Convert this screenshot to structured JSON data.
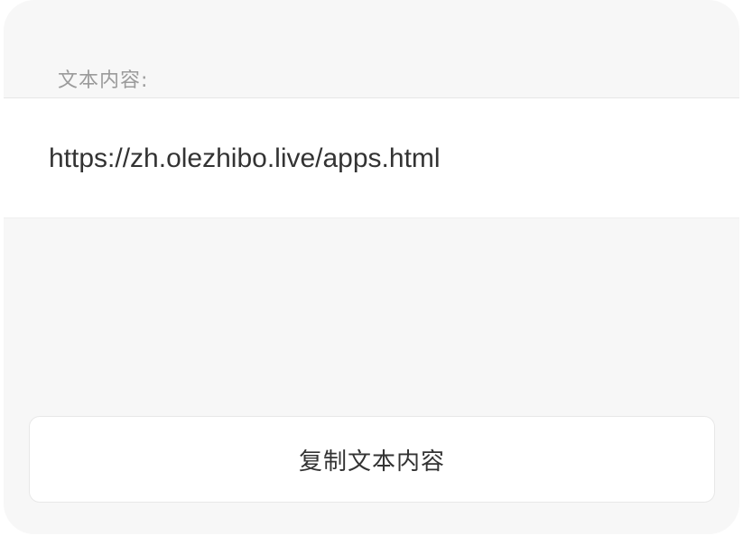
{
  "dialog": {
    "section_label": "文本内容:",
    "content_text": "https://zh.olezhibo.live/apps.html",
    "copy_button_label": "复制文本内容"
  },
  "colors": {
    "dialog_background": "#f7f7f7",
    "panel_background": "#ffffff",
    "label_text": "#9b9b9b",
    "primary_text": "#333333"
  }
}
